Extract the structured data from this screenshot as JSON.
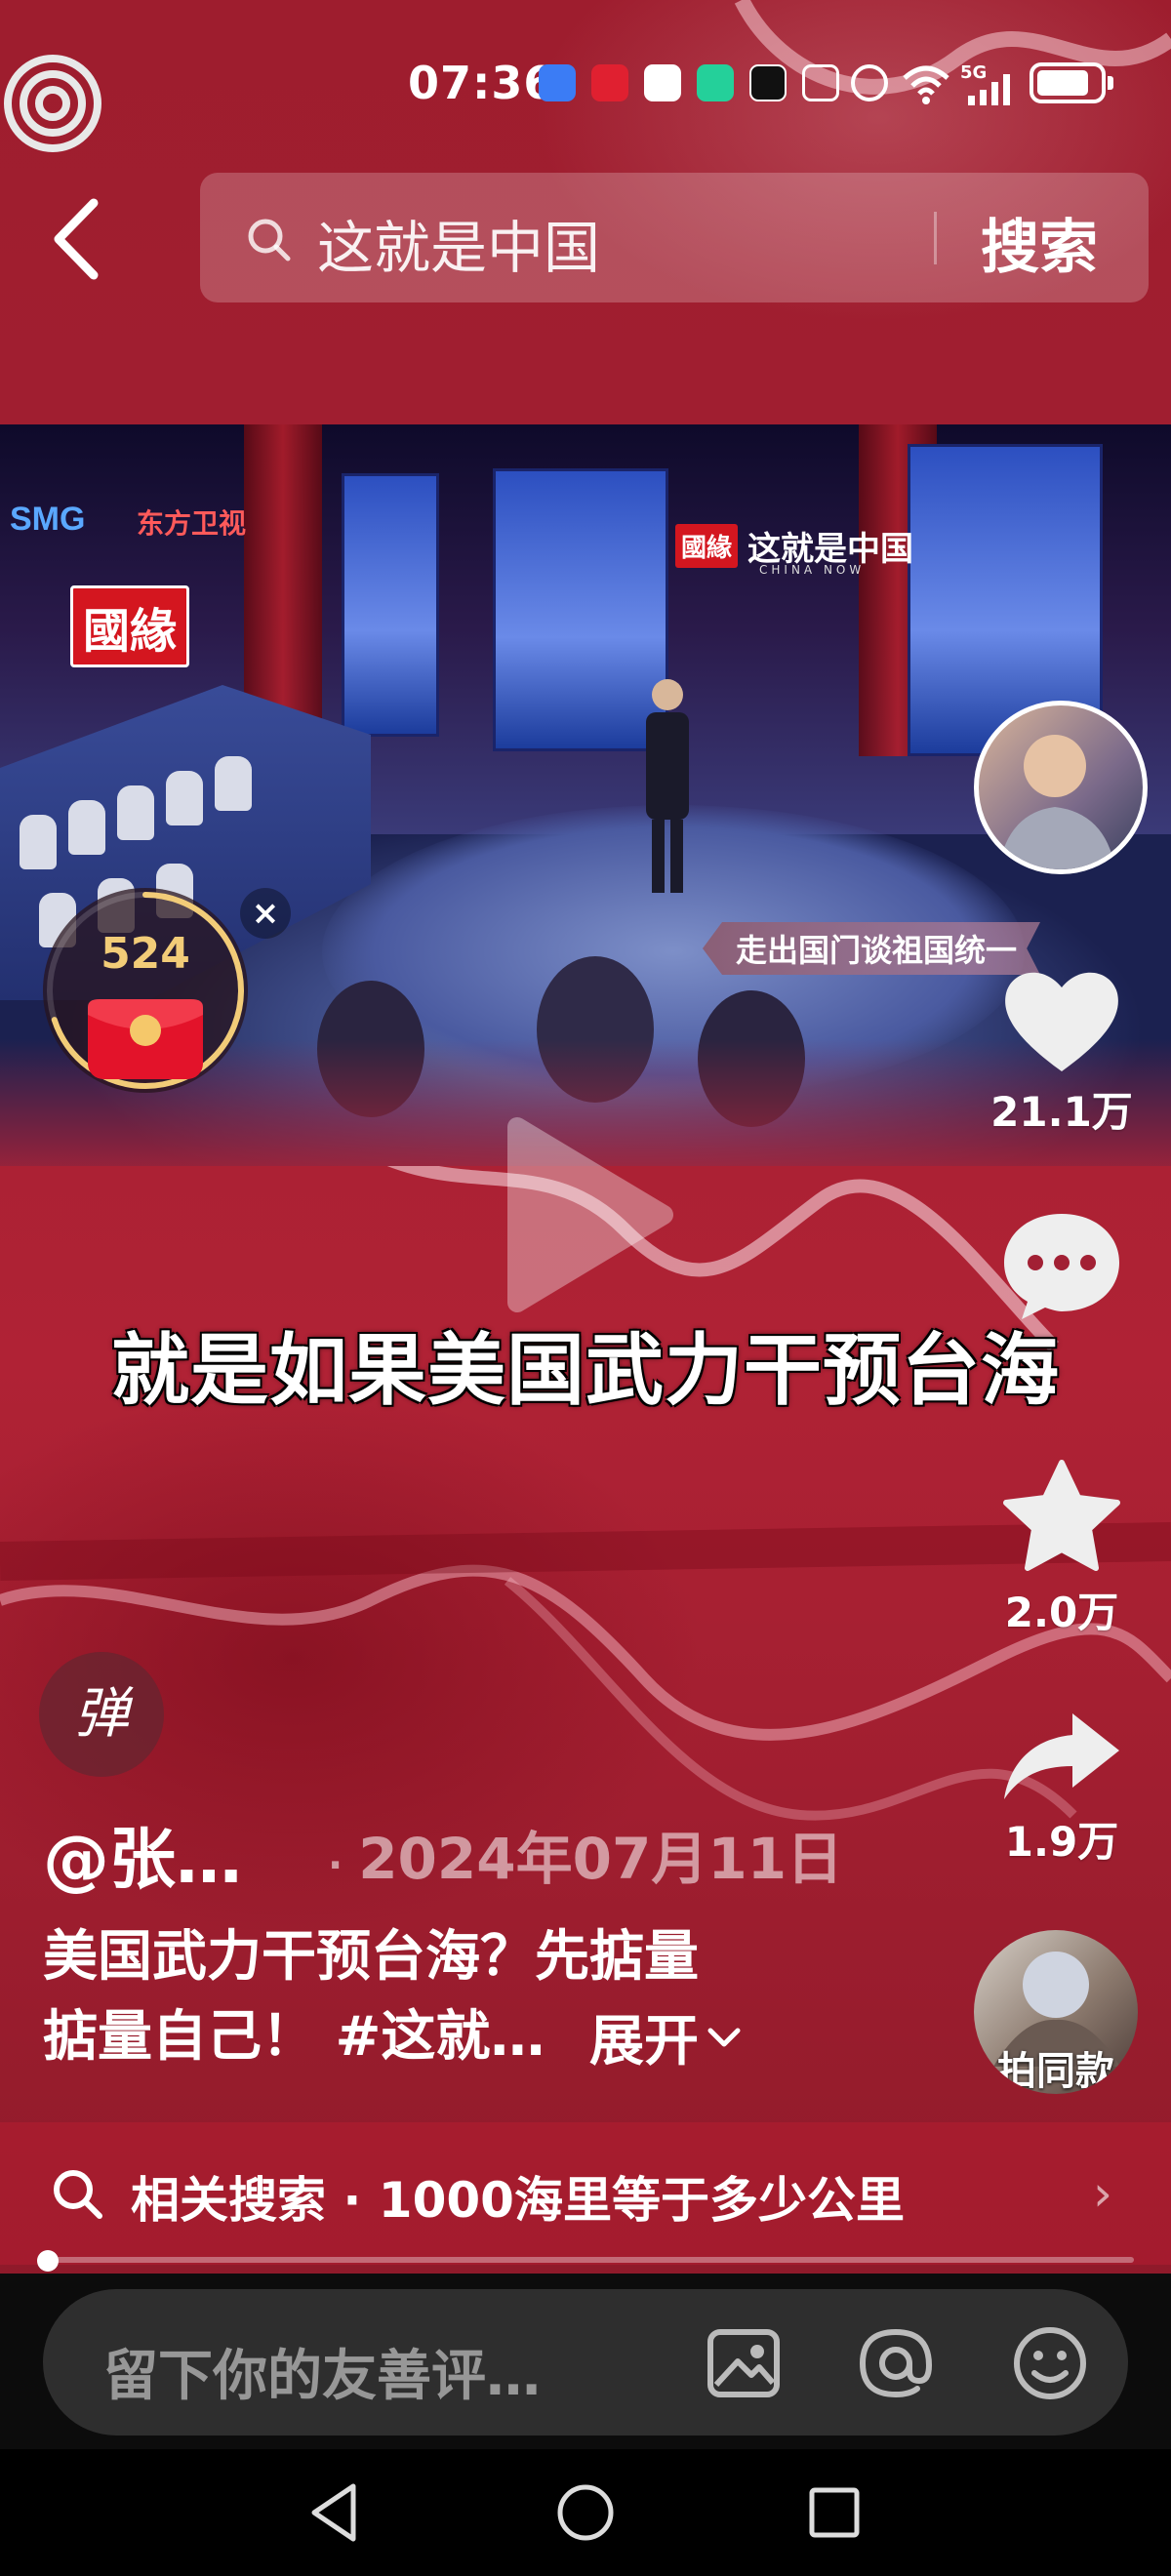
{
  "status_bar": {
    "time": "07:36",
    "network": "5G",
    "battery_level": 0.85,
    "icons": [
      "app-logo-icon",
      "baidu-icon",
      "red-app-icon",
      "panda-app-icon",
      "green-app-icon",
      "tiktok-icon",
      "nfc-icon",
      "alarm-icon",
      "wifi-icon",
      "signal-icon",
      "battery-icon"
    ]
  },
  "header": {
    "back_icon": "chevron-left-icon",
    "search_query": "这就是中国",
    "search_button": "搜索"
  },
  "video": {
    "logos": {
      "smg": "SMG",
      "channel": "东方卫视",
      "badge": "國緣",
      "show_badge": "國緣",
      "show_title": "这就是中国",
      "show_subtitle": "CHINA NOW"
    },
    "lower_caption": "走出国门谈祖国统一",
    "subtitle": "就是如果美国武力干预台海"
  },
  "red_packet": {
    "count": "524",
    "close_icon": "×",
    "progress": 0.7
  },
  "actions": {
    "likes": "21.1万",
    "comments_icon": "comment-icon",
    "favorites": "2.0万",
    "shares": "1.9万",
    "remix_label": "拍同款"
  },
  "danmaku_label": "弹",
  "post": {
    "author": "@张…",
    "date": "2024年07月11日",
    "date_separator": "·",
    "description_line1": "美国武力干预台海？先掂量",
    "description_line2": "掂量自己！ #这就…",
    "expand": "展开"
  },
  "related": {
    "text": "相关搜索 · 1000海里等于多少公里"
  },
  "playback": {
    "progress": 0.01
  },
  "comment_bar": {
    "placeholder": "留下你的友善评…"
  },
  "colors": {
    "background_red": "#a21f31",
    "comment_bg": "#2e2e2e",
    "red_packet_gold": "#f2cc78"
  }
}
